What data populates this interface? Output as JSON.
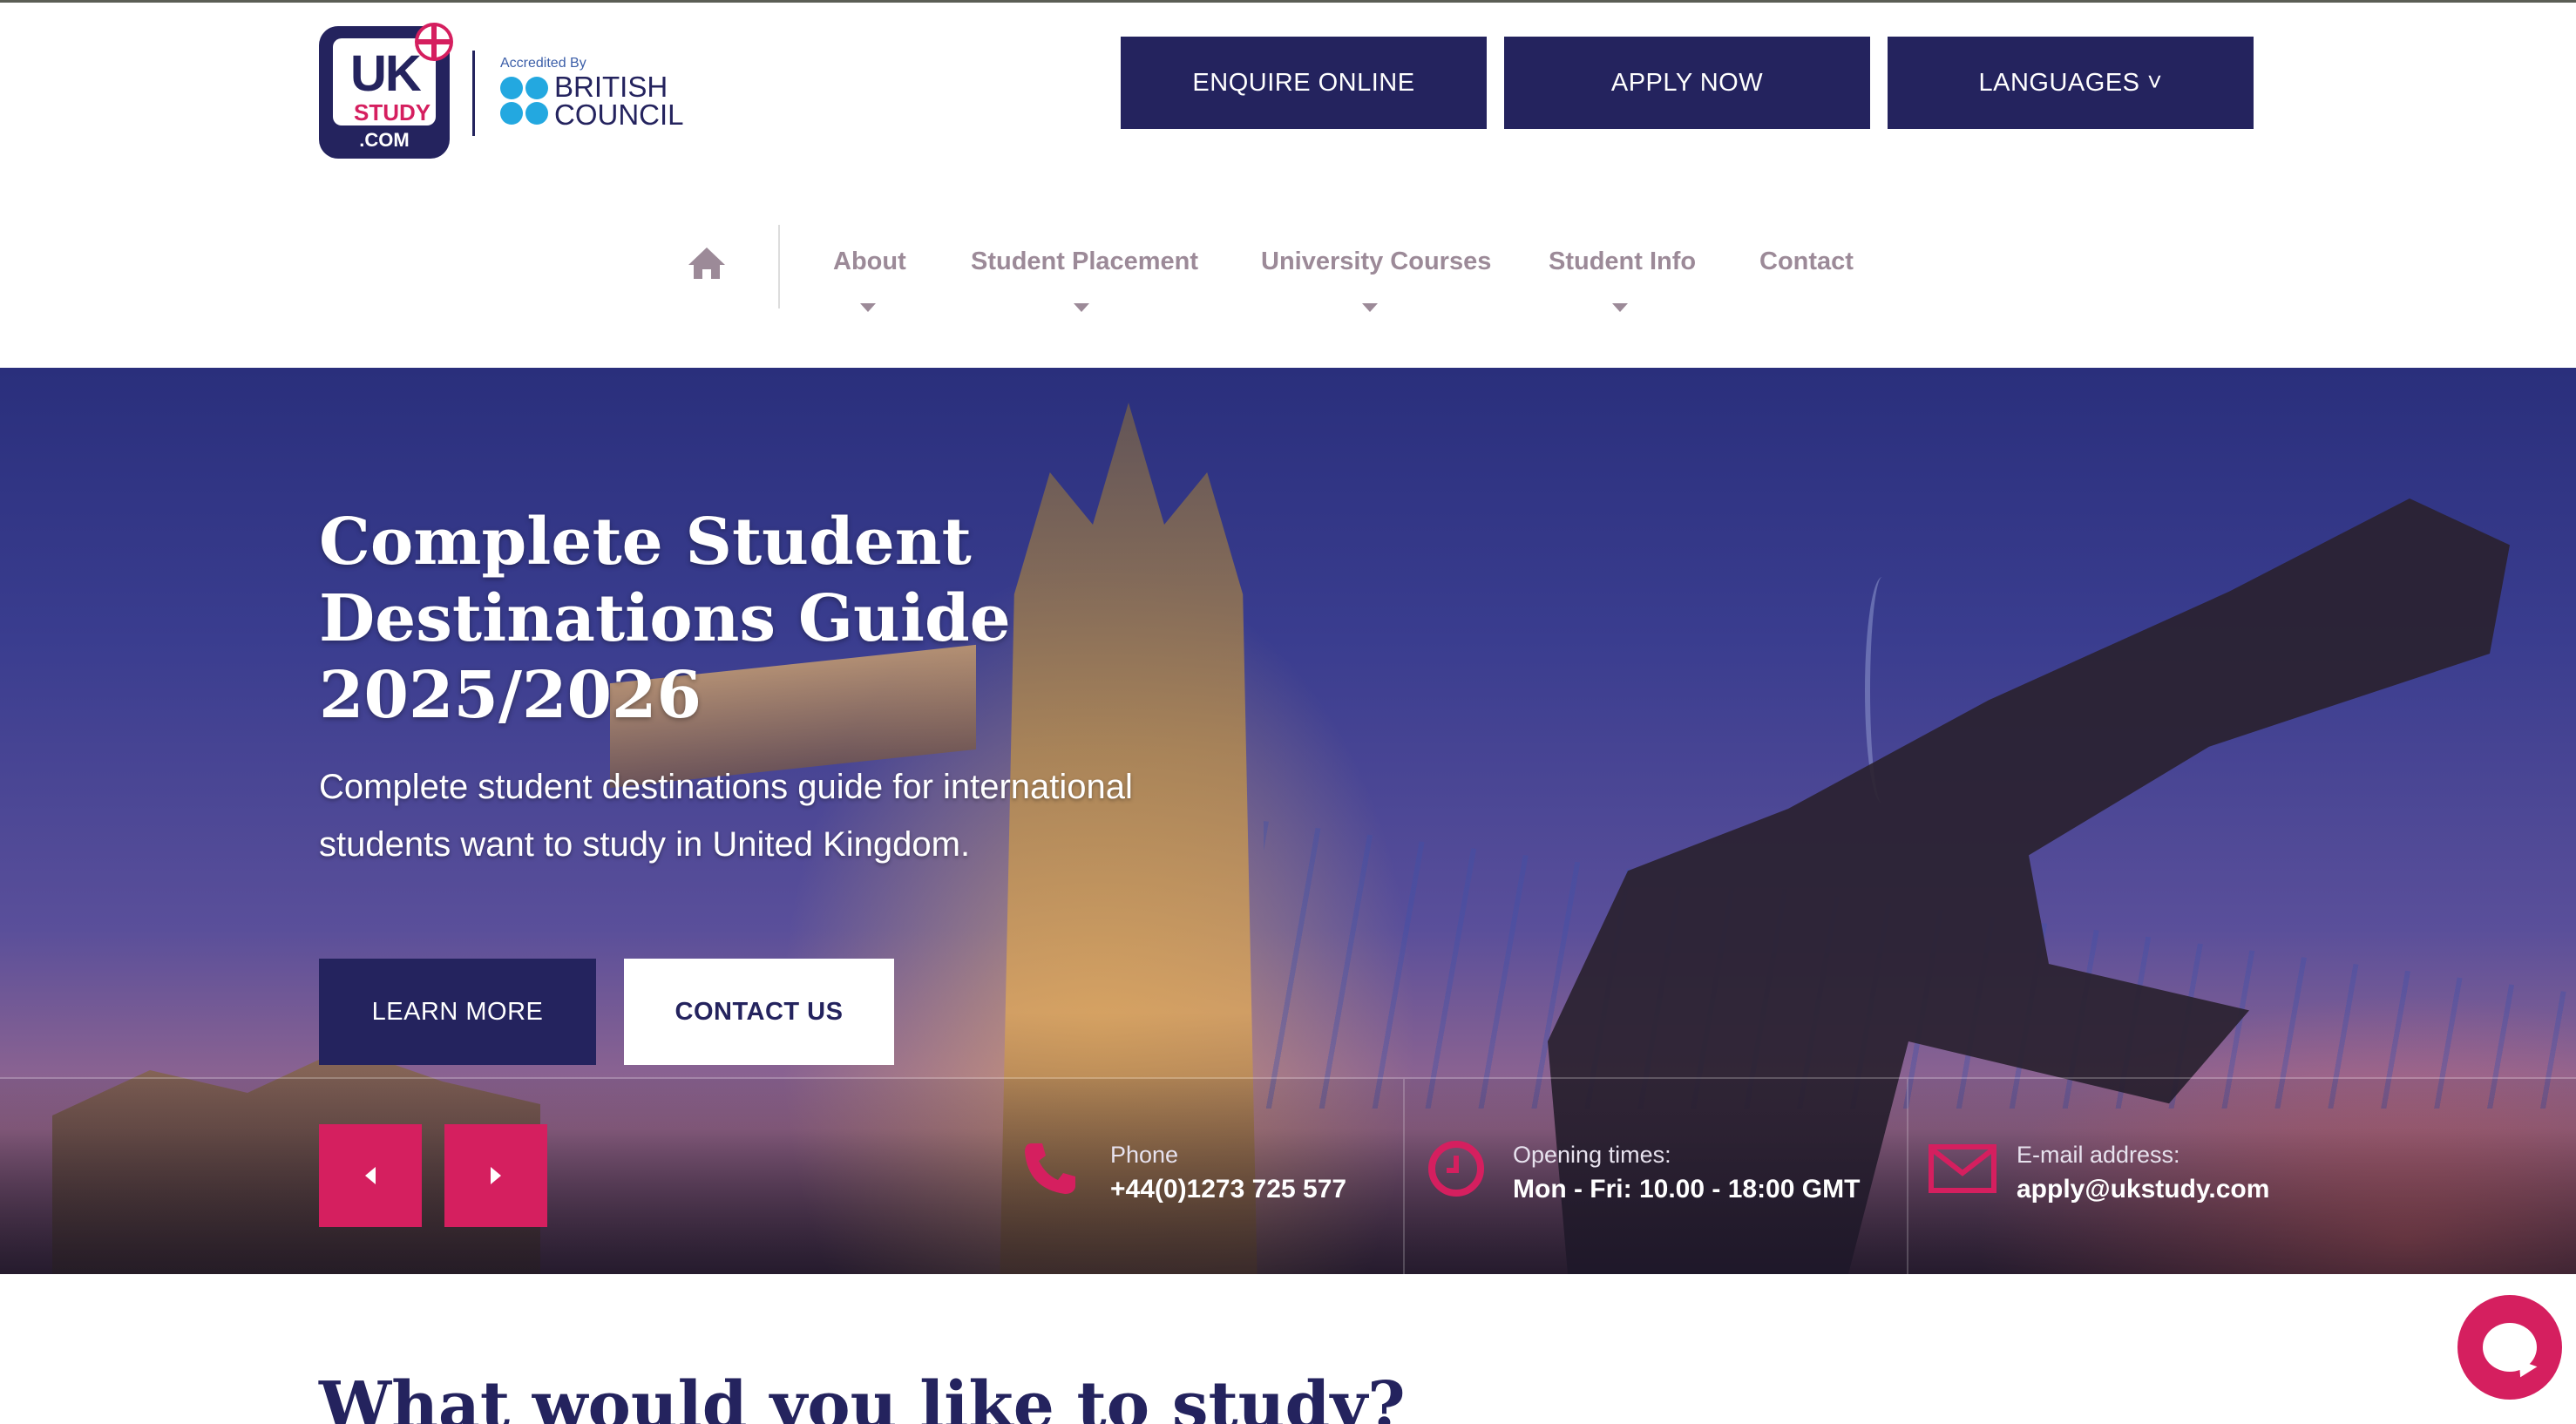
{
  "logo": {
    "uk": "UK",
    "study": "STUDY",
    "com": ".COM",
    "accredited": "Accredited By",
    "british": "BRITISH",
    "council": "COUNCIL"
  },
  "header": {
    "enquire_label": "ENQUIRE ONLINE",
    "apply_label": "APPLY NOW",
    "languages_label": "LANGUAGES ˅"
  },
  "nav": {
    "items": [
      {
        "label": "About",
        "has_dropdown": true
      },
      {
        "label": "Student Placement",
        "has_dropdown": true
      },
      {
        "label": "University Courses",
        "has_dropdown": true
      },
      {
        "label": "Student Info",
        "has_dropdown": true
      },
      {
        "label": "Contact",
        "has_dropdown": false
      }
    ]
  },
  "hero": {
    "title_line1": "Complete Student",
    "title_line2": "Destinations Guide",
    "title_line3": "2025/2026",
    "subtitle": "Complete student destinations guide for international students want to study in United Kingdom.",
    "learn_more_label": "LEARN MORE",
    "contact_us_label": "CONTACT US",
    "prev_arrow": "◀",
    "next_arrow": "▶"
  },
  "info": {
    "phone_label": "Phone",
    "phone_value": "+44(0)1273 725 577",
    "hours_label": "Opening times:",
    "hours_value": "Mon - Fri: 10.00 - 18:00 GMT",
    "email_label": "E-mail address:",
    "email_value": "apply@ukstudy.com"
  },
  "section": {
    "title": "What would you like to study?"
  },
  "colors": {
    "navy": "#24235e",
    "accent": "#d51f5f",
    "nav_text": "#9c8a98",
    "bc_blue": "#23a8e0"
  },
  "icons": {
    "home": "home-icon",
    "phone": "phone-icon",
    "clock": "clock-icon",
    "email": "envelope-icon",
    "chat": "chat-icon"
  }
}
